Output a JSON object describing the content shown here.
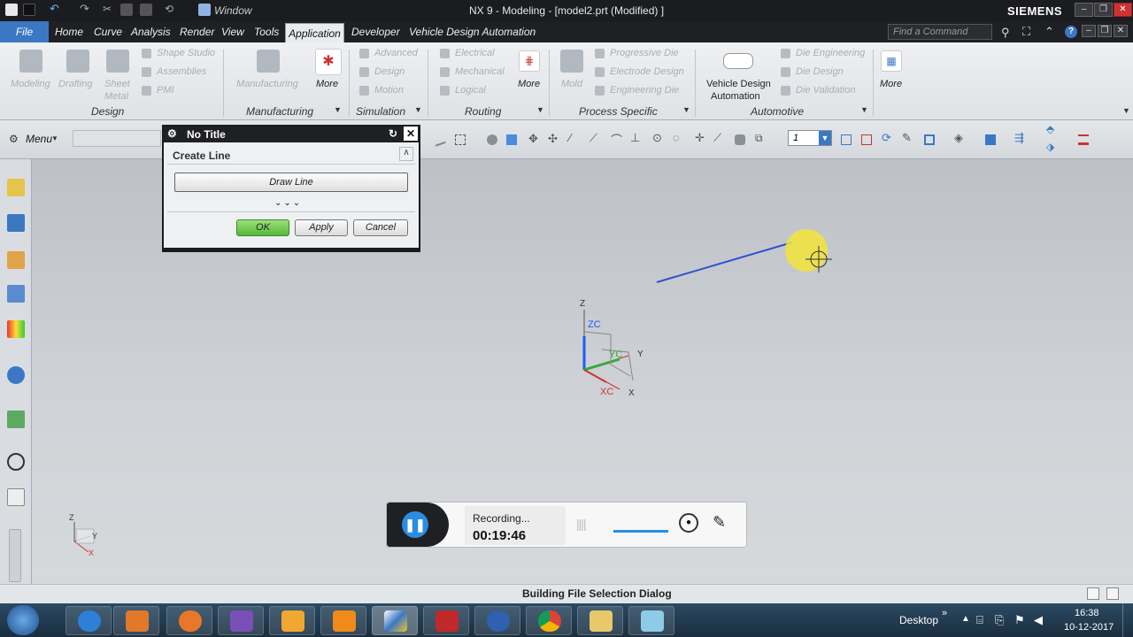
{
  "window": {
    "title": "NX 9 - Modeling - [model2.prt (Modified) ]",
    "brand": "SIEMENS",
    "quick_window": "Window"
  },
  "menu": {
    "file": "File",
    "tabs": [
      "Home",
      "Curve",
      "Analysis",
      "Render",
      "View",
      "Tools",
      "Application",
      "Developer",
      "Vehicle Design Automation"
    ],
    "search_placeholder": "Find a Command"
  },
  "ribbon": {
    "design_large": [
      "Modeling",
      "Drafting",
      "Sheet",
      "Metal"
    ],
    "design_small": [
      "Shape Studio",
      "Assemblies",
      "PMI"
    ],
    "design_group": "Design",
    "manufacturing_btn": "Manufacturing",
    "more": "More",
    "manufacturing_group": "Manufacturing",
    "simulation_items": [
      "Advanced",
      "Design",
      "Motion"
    ],
    "simulation_group": "Simulation",
    "routing_items": [
      "Electrical",
      "Mechanical",
      "Logical"
    ],
    "routing_group": "Routing",
    "mold": "Mold",
    "process_items": [
      "Progressive Die",
      "Electrode Design",
      "Engineering Die"
    ],
    "process_group": "Process Specific",
    "vda_line1": "Vehicle Design",
    "vda_line2": "Automation",
    "automotive_items": [
      "Die Engineering",
      "Die Design",
      "Die Validation"
    ],
    "automotive_group": "Automotive"
  },
  "toolbar": {
    "menu": "Menu",
    "layer_value": "1"
  },
  "dialog": {
    "title": "No Title",
    "section": "Create Line",
    "draw_button": "Draw Line",
    "ok": "OK",
    "apply": "Apply",
    "cancel": "Cancel"
  },
  "triad": {
    "z": "Z",
    "zc": "ZC",
    "y": "Y",
    "yc": "YC",
    "x": "X",
    "xc": "XC"
  },
  "mini_triad": {
    "z": "Z",
    "y": "Y",
    "x": "X"
  },
  "recorder": {
    "status": "Recording...",
    "time": "00:19:46"
  },
  "status": {
    "message": "Building File Selection Dialog"
  },
  "taskbar": {
    "desktop": "Desktop",
    "time": "16:38",
    "date": "10-12-2017"
  },
  "colors": {
    "accent": "#3b78c4",
    "line": "#3050d0",
    "ok_green": "#6ccf4a",
    "cursor_highlight": "#f3e43a"
  }
}
